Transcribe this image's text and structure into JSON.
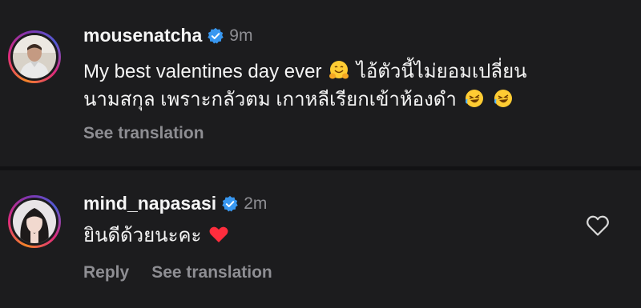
{
  "comments": [
    {
      "username": "mousenatcha",
      "time": "9m",
      "text_line1": "My best valentines day ever",
      "text_line1b": "ไอ้ตัวนี้ไม่ยอมเปลี่ยน",
      "text_line2": "นามสกุล เพราะกลัวตม เกาหลีเรียกเข้าห้องดำ",
      "see_translation": "See translation",
      "emojis": [
        "hugging-face",
        "rofl",
        "rofl"
      ]
    },
    {
      "username": "mind_napasasi",
      "time": "2m",
      "text": "ยินดีด้วยนะคะ",
      "reply": "Reply",
      "see_translation": "See translation",
      "emojis": [
        "red-heart"
      ]
    }
  ],
  "colors": {
    "background": "#1c1c1e",
    "verified": "#3897f0",
    "muted": "#8e8e93"
  }
}
